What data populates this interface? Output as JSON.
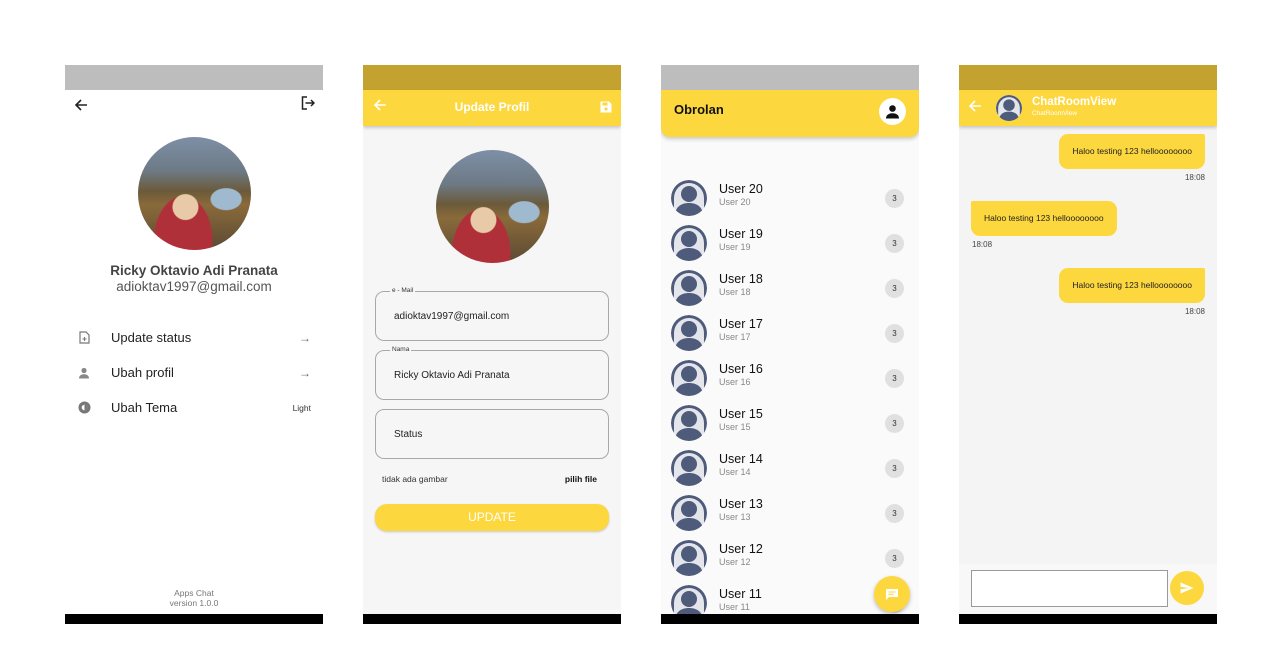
{
  "settings": {
    "name": "Ricky Oktavio Adi Pranata",
    "email": "adioktav1997@gmail.com",
    "menu": [
      {
        "label": "Update status",
        "trailing": "→",
        "icon": "note-add-icon"
      },
      {
        "label": "Ubah profil",
        "trailing": "→",
        "icon": "person-icon"
      },
      {
        "label": "Ubah Tema",
        "trailing": "Light",
        "icon": "theme-icon"
      }
    ],
    "footer_app": "Apps Chat",
    "footer_version": "version 1.0.0",
    "colors": {
      "statusbar": "#bdbdbd"
    }
  },
  "update_profil": {
    "title": "Update Profil",
    "email_label": "e - Mail",
    "email_value": "adioktav1997@gmail.com",
    "nama_label": "Nama",
    "nama_value": "Ricky Oktavio Adi Pranata",
    "status_value": "Status",
    "file_status": "tidak ada gambar",
    "pick_file": "pilih file",
    "update_button": "UPDATE",
    "colors": {
      "accent": "#fdd73e",
      "statusbar": "#c3a22f"
    }
  },
  "obrolan": {
    "title": "Obrolan",
    "chats": [
      {
        "name": "User 20",
        "sub": "User 20",
        "badge": "3"
      },
      {
        "name": "User 19",
        "sub": "User 19",
        "badge": "3"
      },
      {
        "name": "User 18",
        "sub": "User 18",
        "badge": "3"
      },
      {
        "name": "User 17",
        "sub": "User 17",
        "badge": "3"
      },
      {
        "name": "User 16",
        "sub": "User 16",
        "badge": "3"
      },
      {
        "name": "User 15",
        "sub": "User 15",
        "badge": "3"
      },
      {
        "name": "User 14",
        "sub": "User 14",
        "badge": "3"
      },
      {
        "name": "User 13",
        "sub": "User 13",
        "badge": "3"
      },
      {
        "name": "User 12",
        "sub": "User 12",
        "badge": "3"
      },
      {
        "name": "User 11",
        "sub": "User 11",
        "badge": "3"
      }
    ]
  },
  "chatroom": {
    "title": "ChatRoomView",
    "subtitle": "ChatRoomView",
    "messages": [
      {
        "text": "Haloo testing 123 helloooooooo",
        "time": "18:08",
        "side": "right"
      },
      {
        "text": "Haloo testing 123 helloooooooo",
        "time": "18:08",
        "side": "left"
      },
      {
        "text": "Haloo testing 123 helloooooooo",
        "time": "18:08",
        "side": "right"
      }
    ]
  }
}
